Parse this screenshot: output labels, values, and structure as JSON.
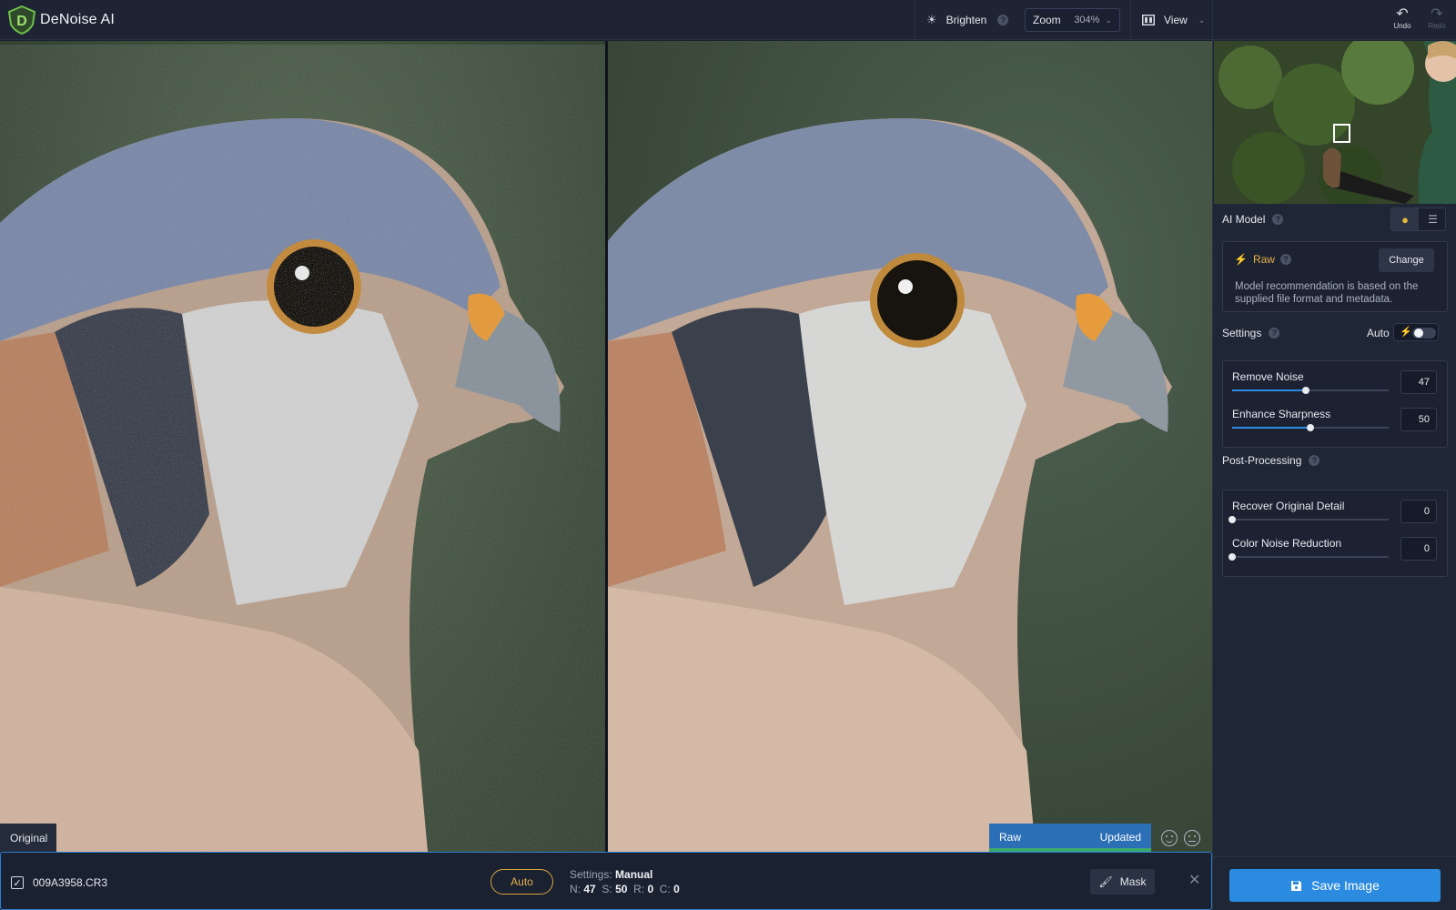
{
  "app": {
    "title": "DeNoise AI"
  },
  "toolbar": {
    "brighten_label": "Brighten",
    "zoom_label": "Zoom",
    "zoom_value": "304%",
    "view_label": "View",
    "undo_label": "Undo",
    "redo_label": "Redo"
  },
  "preview": {
    "left_tag": "Original",
    "status_model": "Raw",
    "status_state": "Updated"
  },
  "file_row": {
    "checked": true,
    "filename": "009A3958.CR3",
    "auto_label": "Auto",
    "settings_prefix": "Settings:",
    "settings_mode": "Manual",
    "n_label": "N:",
    "n_value": "47",
    "s_label": "S:",
    "s_value": "50",
    "r_label": "R:",
    "r_value": "0",
    "c_label": "C:",
    "c_value": "0",
    "mask_label": "Mask"
  },
  "sidebar": {
    "ai_model_title": "AI Model",
    "model_name": "Raw",
    "change_label": "Change",
    "model_description": "Model recommendation is based on the supplied file format and metadata.",
    "settings_title": "Settings",
    "auto_label": "Auto",
    "auto_enabled": false,
    "sliders": [
      {
        "label": "Remove Noise",
        "value": "47",
        "fraction": 0.47
      },
      {
        "label": "Enhance Sharpness",
        "value": "50",
        "fraction": 0.5
      }
    ],
    "post_processing_title": "Post-Processing",
    "post_sliders": [
      {
        "label": "Recover Original Detail",
        "value": "0",
        "fraction": 0.0
      },
      {
        "label": "Color Noise Reduction",
        "value": "0",
        "fraction": 0.0
      }
    ],
    "save_label": "Save Image"
  },
  "colors": {
    "accent_blue": "#2b8be0",
    "accent_gold": "#e3b04b",
    "status_green": "#3aa96b",
    "background": "#1b2130"
  },
  "icons": [
    "logo-icon",
    "brighten-icon",
    "help-icon",
    "chevron-down-icon",
    "view-split-icon",
    "undo-icon",
    "redo-icon",
    "bolt-icon",
    "bulb-icon",
    "list-icon",
    "brush-icon",
    "close-icon",
    "save-icon",
    "smile-icon",
    "neutral-face-icon",
    "check-icon"
  ]
}
